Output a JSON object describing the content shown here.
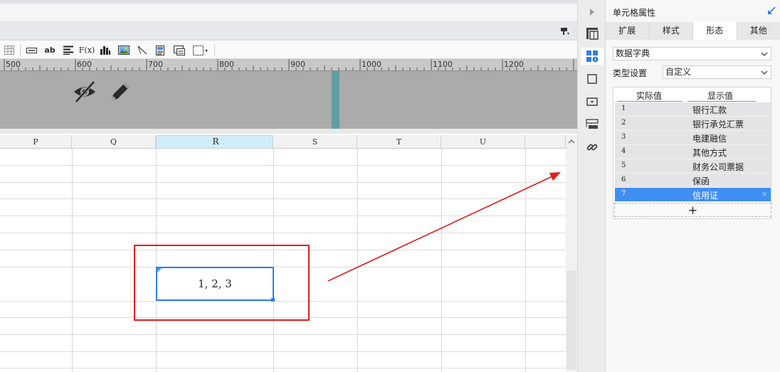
{
  "ruler": {
    "labels": [
      "500",
      "600",
      "700",
      "800",
      "900",
      "1000",
      "1100",
      "1200"
    ]
  },
  "columns": [
    "P",
    "Q",
    "R",
    "S",
    "T",
    "U"
  ],
  "selected_column": "R",
  "selected_cell": {
    "value": "1, 2, 3"
  },
  "canvas_icons": [
    "eye-off-icon",
    "pencil-icon"
  ],
  "toolbar_icons": [
    "grid-icon",
    "field-icon",
    "text-ab-icon",
    "align-icon",
    "formula-icon",
    "bar-chart-icon",
    "image-icon",
    "slash-icon",
    "document-icon",
    "sub-report-icon",
    "border-icon"
  ],
  "toolbar_text": {
    "ab": "ab",
    "fx": "F(x)"
  },
  "rail_icons": [
    "arrow-right-icon",
    "cell-element-icon",
    "cell-properties-icon",
    "condition-icon",
    "widget-icon",
    "widget-list-icon",
    "hyperlink-icon"
  ],
  "panel": {
    "title": "单元格属性",
    "tabs": [
      "扩展",
      "样式",
      "形态",
      "其他"
    ],
    "active_tab": "形态",
    "form_type": "数据字典",
    "type_setting_label": "类型设置",
    "type_setting_value": "自定义",
    "dict_headers": {
      "actual": "实际值",
      "display": "显示值"
    },
    "dict_rows": [
      {
        "actual": "1",
        "display": "银行汇款"
      },
      {
        "actual": "2",
        "display": "银行承兑汇票"
      },
      {
        "actual": "3",
        "display": "电建融信"
      },
      {
        "actual": "4",
        "display": "其他方式"
      },
      {
        "actual": "5",
        "display": "财务公司票据"
      },
      {
        "actual": "6",
        "display": "保函"
      },
      {
        "actual": "7",
        "display": "信用证"
      }
    ],
    "selected_row": "7",
    "add_label": "+"
  },
  "colors": {
    "accent": "#2f7ee5",
    "annotation": "#e21c1c",
    "row_selected": "#3f8ff3"
  }
}
